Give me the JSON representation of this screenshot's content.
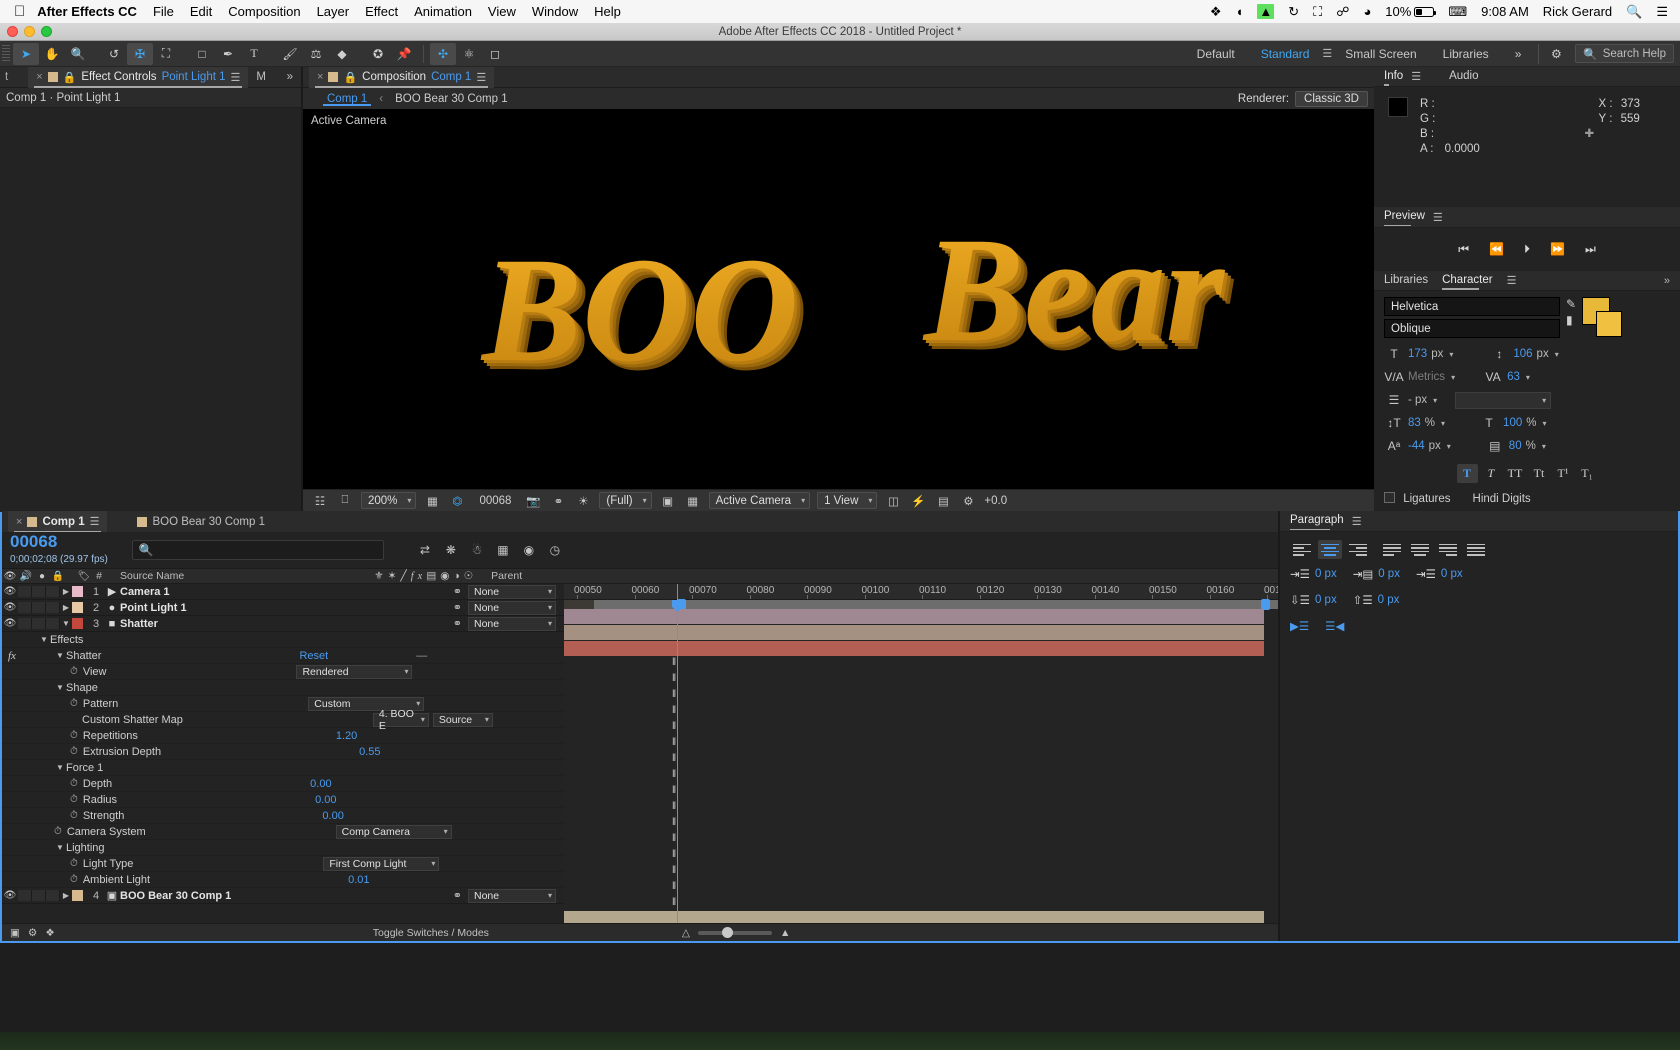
{
  "macbar": {
    "app_name": "After Effects CC",
    "menus": [
      "File",
      "Edit",
      "Composition",
      "Layer",
      "Effect",
      "Animation",
      "View",
      "Window",
      "Help"
    ],
    "battery": "10%",
    "time": "9:08 AM",
    "user": "Rick Gerard"
  },
  "window": {
    "title": "Adobe After Effects CC 2018 - Untitled Project *"
  },
  "toolbar": {
    "workspaces": [
      "Default",
      "Standard",
      "Small Screen",
      "Libraries"
    ],
    "active_workspace": "Standard",
    "overflow": "»",
    "search_placeholder": "Search Help"
  },
  "effect_controls": {
    "tab_label": "Effect Controls",
    "tab_target": "Point Light 1",
    "partial_tab": "M",
    "breadcrumb": "Comp 1 · Point Light 1"
  },
  "composition": {
    "tab_label": "Composition",
    "tab_target": "Comp 1",
    "subtabs": [
      "Comp 1",
      "BOO Bear 30 Comp 1"
    ],
    "active_subtab": "Comp 1",
    "renderer_label": "Renderer:",
    "renderer_value": "Classic 3D",
    "view_label": "Active Camera",
    "artwork_text": "BOO Bear",
    "artwork_color": "#d99a1e",
    "toolbar": {
      "zoom": "200%",
      "frame": "00068",
      "resolution": "(Full)",
      "camera": "Active Camera",
      "views": "1 View",
      "exposure": "+0.0"
    }
  },
  "info": {
    "tabs": [
      "Info",
      "Audio"
    ],
    "active_tab": "Info",
    "labels": [
      "R :",
      "G :",
      "B :",
      "A :"
    ],
    "alpha": "0.0000",
    "x_label": "X :",
    "x_value": "373",
    "y_label": "Y :",
    "y_value": "559"
  },
  "preview": {
    "title": "Preview"
  },
  "character": {
    "tabs": [
      "Libraries",
      "Character"
    ],
    "active_tab": "Character",
    "font_family": "Helvetica",
    "font_style": "Oblique",
    "font_size": "173",
    "font_size_unit": "px",
    "leading": "106",
    "leading_unit": "px",
    "kerning": "Metrics",
    "tracking": "63",
    "stroke_width": "- px",
    "vertical_scale": "83",
    "vertical_scale_unit": "%",
    "horizontal_scale": "100",
    "horizontal_scale_unit": "%",
    "baseline_shift": "-44",
    "baseline_shift_unit": "px",
    "tsume": "80",
    "tsume_unit": "%",
    "style_buttons": [
      "T",
      "T",
      "TT",
      "Tt",
      "T¹",
      "T₁"
    ],
    "ligatures_label": "Ligatures",
    "hindi_label": "Hindi Digits"
  },
  "paragraph": {
    "title": "Paragraph",
    "indent_left": "0 px",
    "indent_right": "0 px",
    "indent_first": "0 px",
    "space_before": "0 px",
    "space_after": "0 px"
  },
  "timeline": {
    "tabs": [
      "Comp 1",
      "BOO Bear 30 Comp 1"
    ],
    "active_tab": "Comp 1",
    "timecode": "00068",
    "timecode_sub": "0;00;02;08 (29.97 fps)",
    "search_placeholder": "",
    "columns": [
      "#",
      "Source Name",
      "Parent"
    ],
    "toggle_label": "Toggle Switches / Modes",
    "ruler_labels": [
      "00050",
      "00060",
      "00070",
      "00080",
      "00090",
      "00100",
      "00110",
      "00120",
      "00130",
      "00140",
      "00150",
      "00160",
      "001"
    ],
    "layers": [
      {
        "num": "1",
        "name": "Camera 1",
        "color": "#e8b9c8",
        "icon": "camera-icon",
        "parent": "None",
        "bar_color": "#a08893"
      },
      {
        "num": "2",
        "name": "Point Light 1",
        "color": "#e8c9a5",
        "icon": "light-icon",
        "parent": "None",
        "bar_color": "#a49182"
      },
      {
        "num": "3",
        "name": "Shatter",
        "color": "#c4483c",
        "icon": "solid-icon",
        "parent": "None",
        "bar_color": "#b35f54"
      },
      {
        "num": "4",
        "name": "BOO Bear 30 Comp 1",
        "color": "#d6b98d",
        "icon": "comp-icon",
        "parent": "None",
        "bar_color": "#b3a78d"
      }
    ],
    "properties": [
      {
        "indent": 1,
        "label": "Effects",
        "type": "group",
        "value": ""
      },
      {
        "indent": 2,
        "label": "Shatter",
        "type": "effect",
        "value": "Reset"
      },
      {
        "indent": 3,
        "label": "View",
        "type": "dropdown",
        "value": "Rendered"
      },
      {
        "indent": 2,
        "label": "Shape",
        "type": "group",
        "value": ""
      },
      {
        "indent": 3,
        "label": "Pattern",
        "type": "dropdown",
        "value": "Custom"
      },
      {
        "indent": 3,
        "label": "Custom Shatter Map",
        "type": "dropdown2",
        "value": "4. BOO E",
        "value2": "Source"
      },
      {
        "indent": 3,
        "label": "Repetitions",
        "type": "number",
        "value": "1.20"
      },
      {
        "indent": 3,
        "label": "Extrusion Depth",
        "type": "number",
        "value": "0.55"
      },
      {
        "indent": 2,
        "label": "Force 1",
        "type": "group",
        "value": ""
      },
      {
        "indent": 3,
        "label": "Depth",
        "type": "number",
        "value": "0.00"
      },
      {
        "indent": 3,
        "label": "Radius",
        "type": "number",
        "value": "0.00"
      },
      {
        "indent": 3,
        "label": "Strength",
        "type": "number",
        "value": "0.00"
      },
      {
        "indent": 2,
        "label": "Camera System",
        "type": "dropdown",
        "value": "Comp Camera"
      },
      {
        "indent": 2,
        "label": "Lighting",
        "type": "group",
        "value": ""
      },
      {
        "indent": 3,
        "label": "Light Type",
        "type": "dropdown",
        "value": "First Comp Light"
      },
      {
        "indent": 3,
        "label": "Ambient Light",
        "type": "number",
        "value": "0.01"
      }
    ]
  }
}
